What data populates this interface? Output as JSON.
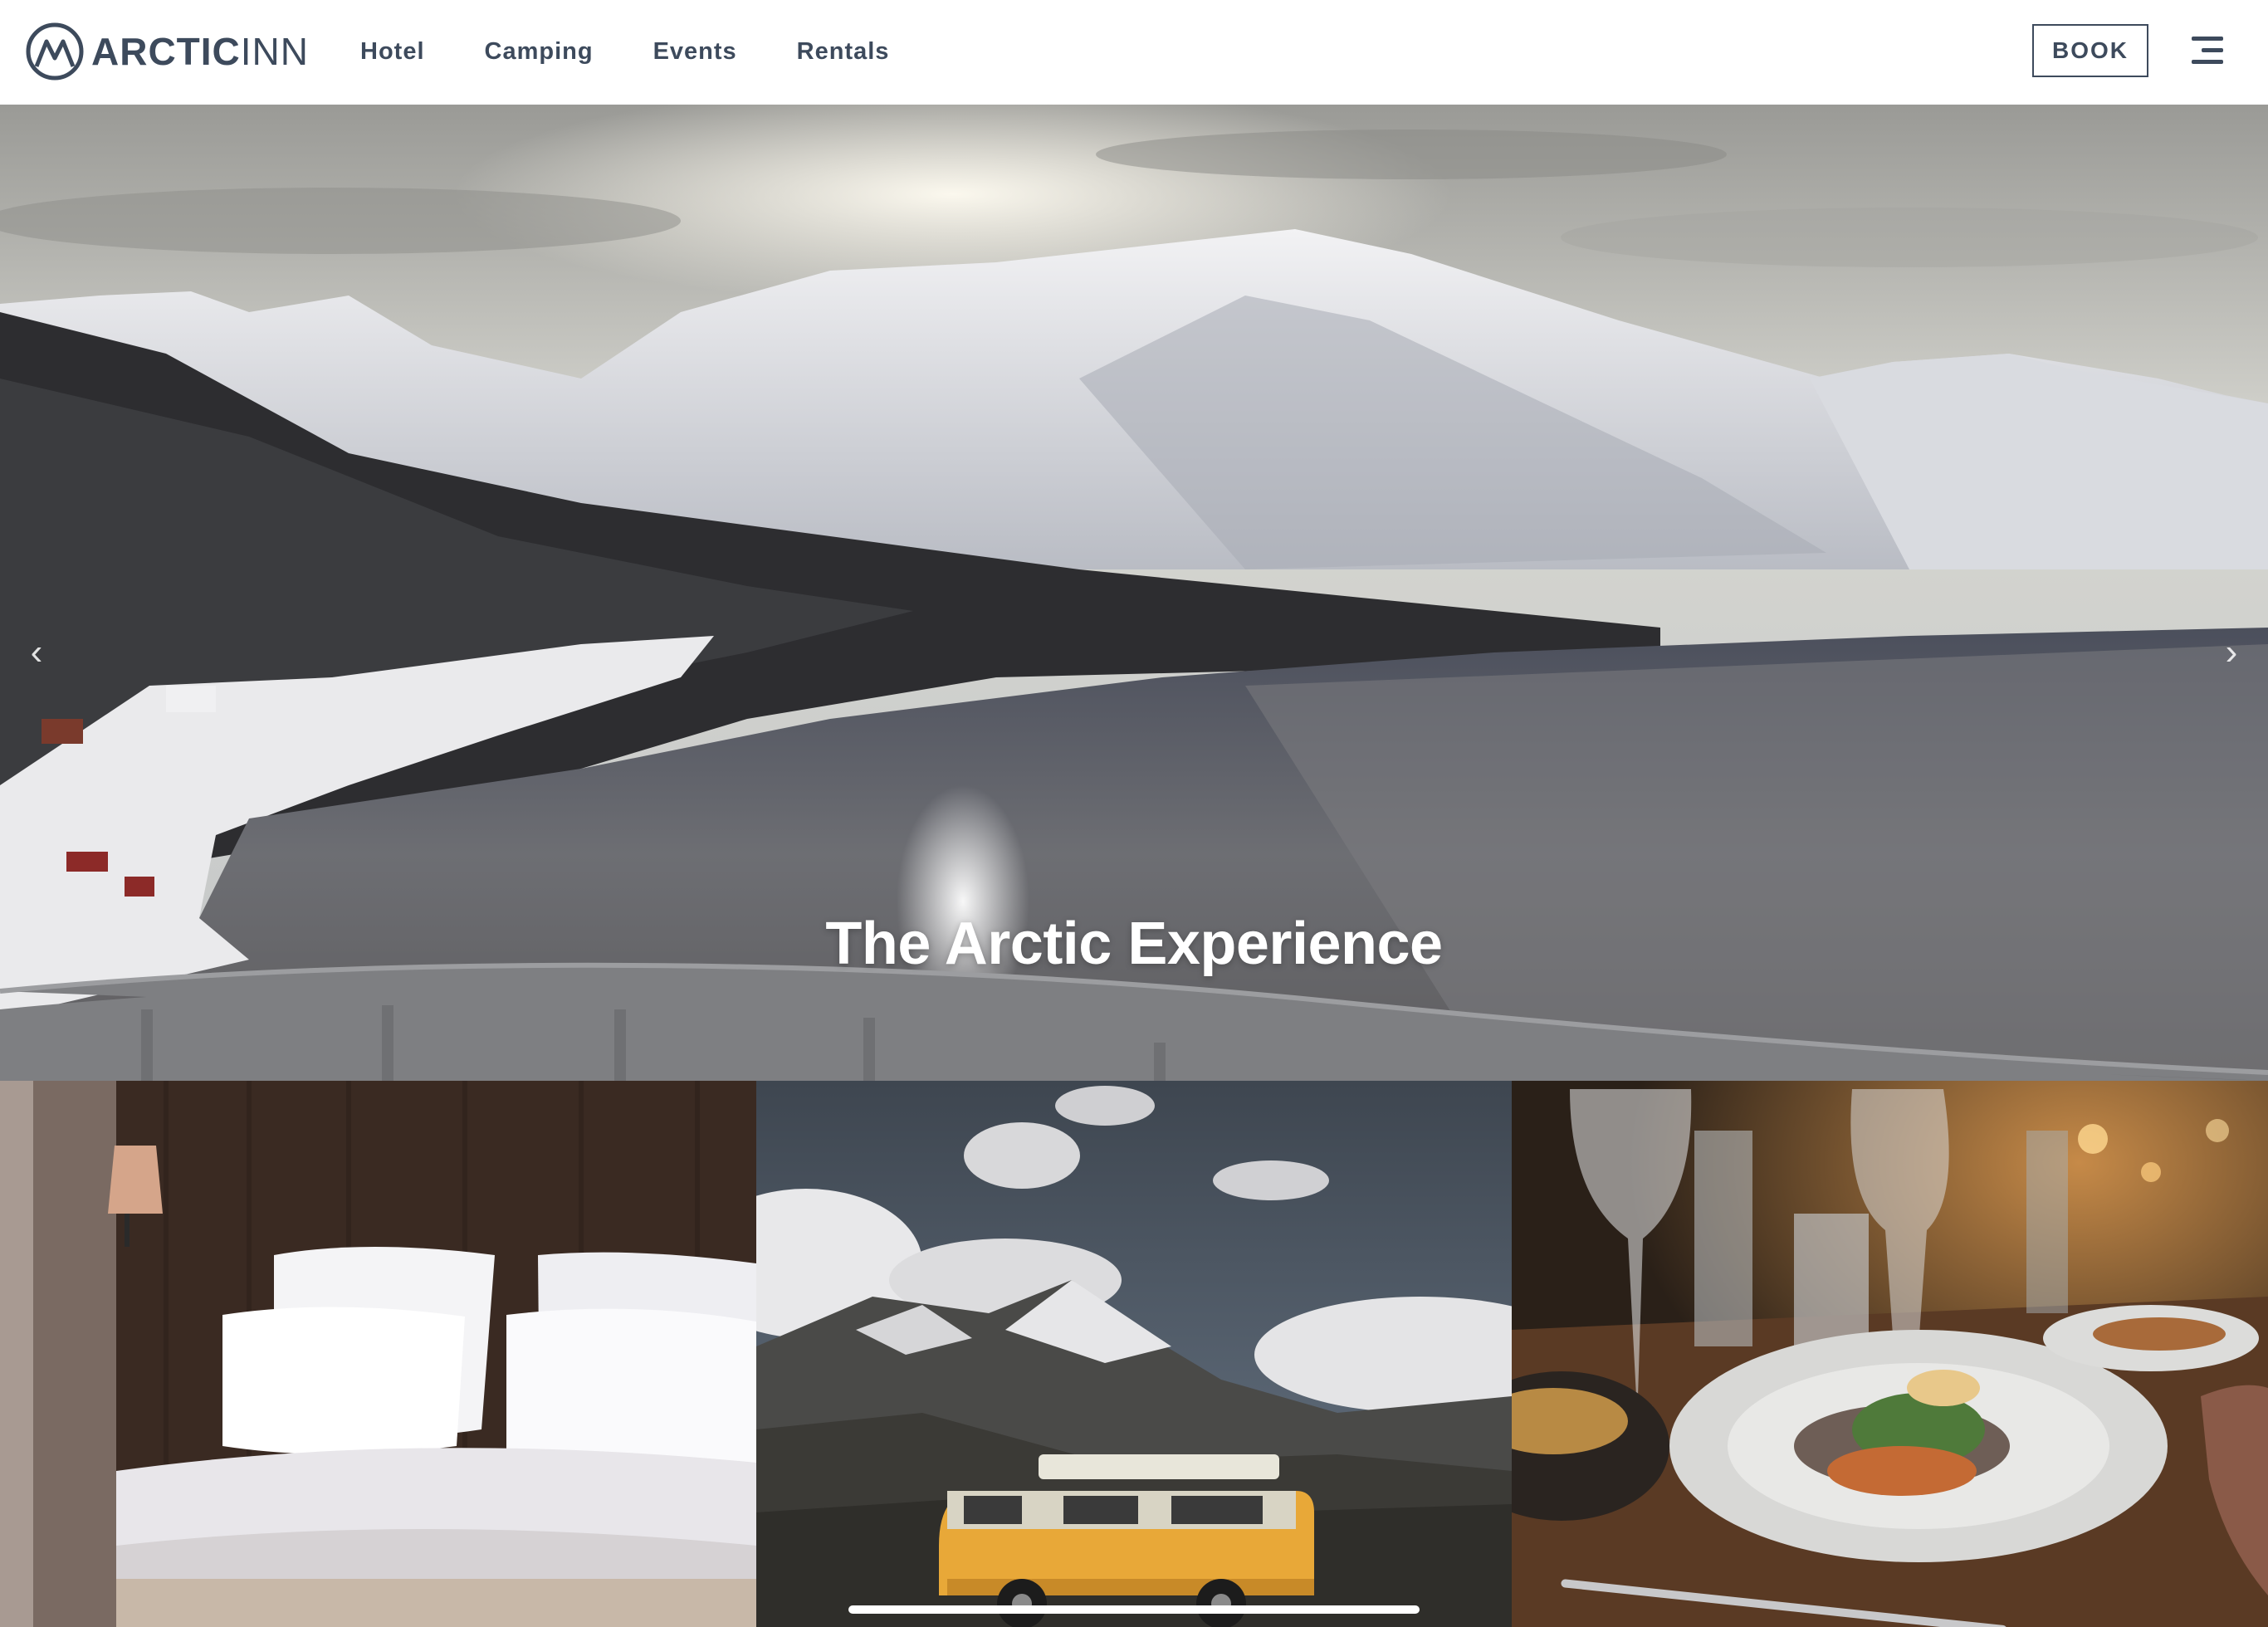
{
  "brand": {
    "name_bold": "ARCTIC",
    "name_light": "INN",
    "logo_icon": "mountain-circle-logo-icon"
  },
  "nav": {
    "items": [
      {
        "label": "Hotel"
      },
      {
        "label": "Camping"
      },
      {
        "label": "Events"
      },
      {
        "label": "Rentals"
      }
    ],
    "book_label": "BOOK",
    "menu_icon": "hamburger-menu-icon"
  },
  "hero": {
    "title": "The Arctic Experience",
    "prev_glyph": "‹",
    "next_glyph": "›"
  },
  "tiles": [
    {
      "name": "hotel-room-image"
    },
    {
      "name": "camper-van-mountains-image"
    },
    {
      "name": "restaurant-dinner-image"
    }
  ],
  "colors": {
    "nav_text": "#3d4a5c",
    "header_bg": "#ffffff",
    "hero_title": "#ffffff"
  }
}
